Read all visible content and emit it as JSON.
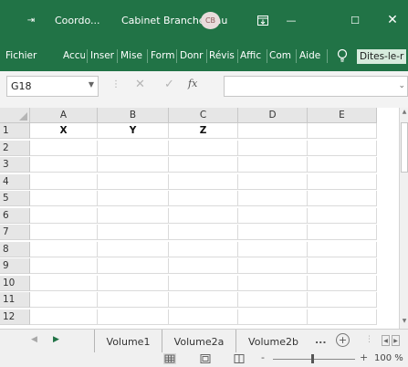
{
  "titlebar": {
    "qat_glyph": "⇥",
    "doc_name": "Coordo...",
    "user_name": "Cabinet Branchereau",
    "user_initials": "CB",
    "minimize_glyph": "—",
    "maximize_glyph": "☐",
    "close_glyph": "✕",
    "color": "#217346"
  },
  "tabs": [
    "Fichier",
    "Accu",
    "Inser",
    "Mise",
    "Form",
    "Donr",
    "Révis",
    "Affic",
    "Com",
    "Aide"
  ],
  "tell_me": "Dites-le-r",
  "formula_bar": {
    "namebox": "G18",
    "fx": "fx",
    "cancel_glyph": "✕",
    "enter_glyph": "✓",
    "value": ""
  },
  "grid": {
    "columns": [
      "A",
      "B",
      "C",
      "D",
      "E"
    ],
    "rows": [
      "1",
      "2",
      "3",
      "4",
      "5",
      "6",
      "7",
      "8",
      "9",
      "10",
      "11",
      "12"
    ],
    "cells": [
      [
        "X",
        "Y",
        "Z",
        "",
        ""
      ]
    ]
  },
  "sheets": {
    "tabs": [
      "Volume1",
      "Volume2a",
      "Volume2b"
    ],
    "more": "...",
    "add": "+"
  },
  "status": {
    "zoom_minus": "-",
    "zoom_plus": "+",
    "zoom_level": "100 %",
    "zoom_percent": 100
  }
}
